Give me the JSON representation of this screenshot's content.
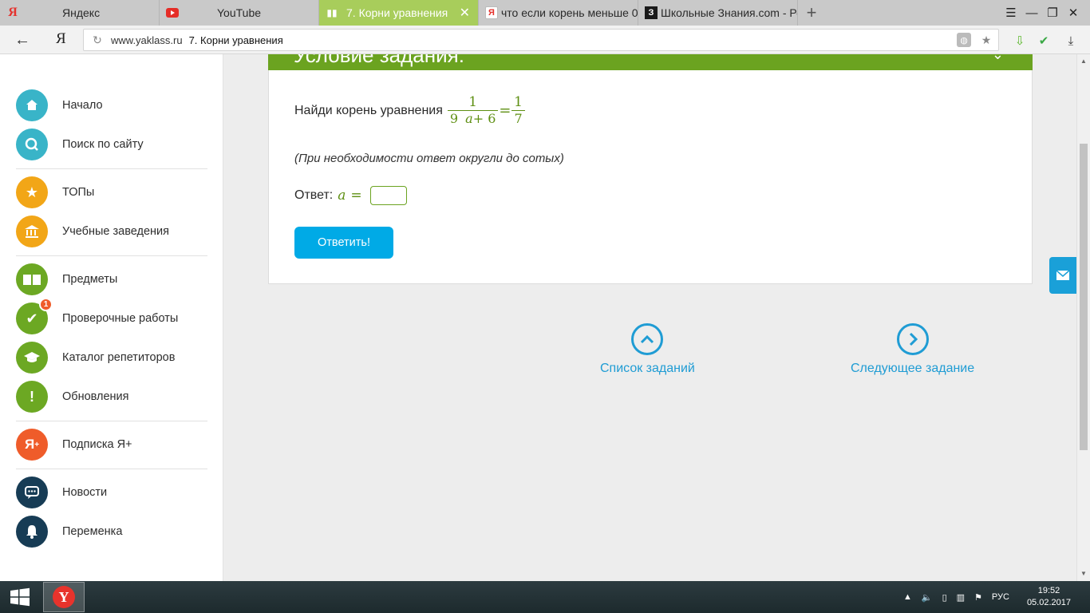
{
  "browser": {
    "tabs": [
      {
        "title": "Яндекс",
        "icon": "yandex-icon",
        "active": false
      },
      {
        "title": "YouTube",
        "icon": "youtube-icon",
        "active": false
      },
      {
        "title": "7. Корни уравнения",
        "icon": "book-icon",
        "active": true
      },
      {
        "title": "что если корень меньше 0",
        "icon": "yandex-icon",
        "active": false
      },
      {
        "title": "Школьные Знания.com - Ре",
        "icon": "znania-icon",
        "active": false
      }
    ],
    "address": {
      "host": "www.yaklass.ru",
      "title": "7. Корни уравнения"
    }
  },
  "sidebar": {
    "items": [
      {
        "label": "Начало",
        "icon": "home-icon",
        "color": "#39b4c8"
      },
      {
        "label": "Поиск по сайту",
        "icon": "search-icon",
        "color": "#39b4c8"
      },
      {
        "label": "ТОПы",
        "icon": "star-icon",
        "color": "#f2a617"
      },
      {
        "label": "Учебные заведения",
        "icon": "institution-icon",
        "color": "#f2a617"
      },
      {
        "label": "Предметы",
        "icon": "book-open-icon",
        "color": "#6ca823"
      },
      {
        "label": "Проверочные работы",
        "icon": "check-icon",
        "color": "#6ca823",
        "badge": "1"
      },
      {
        "label": "Каталог репетиторов",
        "icon": "graduation-cap-icon",
        "color": "#6ca823"
      },
      {
        "label": "Обновления",
        "icon": "exclamation-icon",
        "color": "#6ca823"
      },
      {
        "label": "Подписка Я+",
        "icon": "ya-plus-icon",
        "color": "#ef5c2a"
      },
      {
        "label": "Новости",
        "icon": "chat-icon",
        "color": "#173c55"
      },
      {
        "label": "Переменка",
        "icon": "bell-icon",
        "color": "#173c55"
      }
    ]
  },
  "task": {
    "header_title": "Условие задания:",
    "question": "Найди корень уравнения",
    "equation": {
      "left_num": "1",
      "left_den_coef": "9",
      "left_den_var": "a",
      "left_den_rest": "+ 6",
      "equals": "=",
      "right_num": "1",
      "right_den": "7"
    },
    "hint": "(При необходимости ответ округли до сотых)",
    "answer_label": "Ответ:",
    "answer_var": "a",
    "answer_eq": "=",
    "answer_value": "",
    "submit_label": "Ответить!"
  },
  "nav": {
    "list_label": "Список заданий",
    "next_label": "Следующее задание"
  },
  "taskbar": {
    "language": "РУС",
    "time": "19:52",
    "date": "05.02.2017"
  },
  "colors": {
    "accent_green": "#6ba320",
    "button_blue": "#00aae6",
    "link_blue": "#1f9cd4"
  }
}
